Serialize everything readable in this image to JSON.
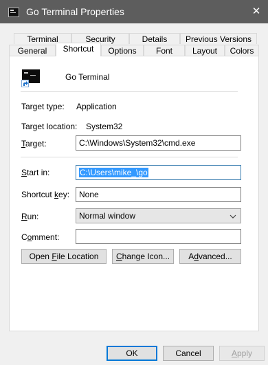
{
  "window": {
    "title": "Go Terminal Properties",
    "close_glyph": "✕"
  },
  "tabs_row1": [
    {
      "label": "Terminal"
    },
    {
      "label": "Security"
    },
    {
      "label": "Details"
    },
    {
      "label": "Previous Versions"
    }
  ],
  "tabs_row2": [
    {
      "label": "General"
    },
    {
      "label": "Shortcut",
      "active": true
    },
    {
      "label": "Options"
    },
    {
      "label": "Font"
    },
    {
      "label": "Layout"
    },
    {
      "label": "Colors"
    }
  ],
  "shortcut": {
    "name": "Go Terminal",
    "target_type_label": "Target type:",
    "target_type_value": "Application",
    "target_location_label": "Target location:",
    "target_location_value": "System32",
    "target_label_pre": "",
    "target_label_u": "T",
    "target_label_post": "arget:",
    "target_value": "C:\\Windows\\System32\\cmd.exe",
    "start_in_label_pre": "",
    "start_in_label_u": "S",
    "start_in_label_post": "tart in:",
    "start_in_value": "C:\\Users\\mike_\\go",
    "shortcut_key_label_pre": "Shortcut ",
    "shortcut_key_label_u": "k",
    "shortcut_key_label_post": "ey:",
    "shortcut_key_value": "None",
    "run_label_pre": "",
    "run_label_u": "R",
    "run_label_post": "un:",
    "run_value": "Normal window",
    "comment_label_pre": "C",
    "comment_label_u": "o",
    "comment_label_post": "mment:",
    "comment_value": ""
  },
  "buttons": {
    "open_location_pre": "Open ",
    "open_location_u": "F",
    "open_location_post": "ile Location",
    "change_icon_pre": "",
    "change_icon_u": "C",
    "change_icon_post": "hange Icon...",
    "advanced_pre": "A",
    "advanced_u": "d",
    "advanced_post": "vanced...",
    "ok": "OK",
    "cancel": "Cancel",
    "apply_pre": "",
    "apply_u": "A",
    "apply_post": "pply"
  },
  "icons": {
    "title_icon": "console-icon",
    "app_icon": "console-icon",
    "overlay": "shortcut-arrow-icon",
    "dropdown": "chevron-down-icon",
    "close": "close-icon"
  },
  "colors": {
    "titlebar": "#5d5d5d",
    "selection": "#3399ff",
    "default_button_border": "#0078d7"
  }
}
